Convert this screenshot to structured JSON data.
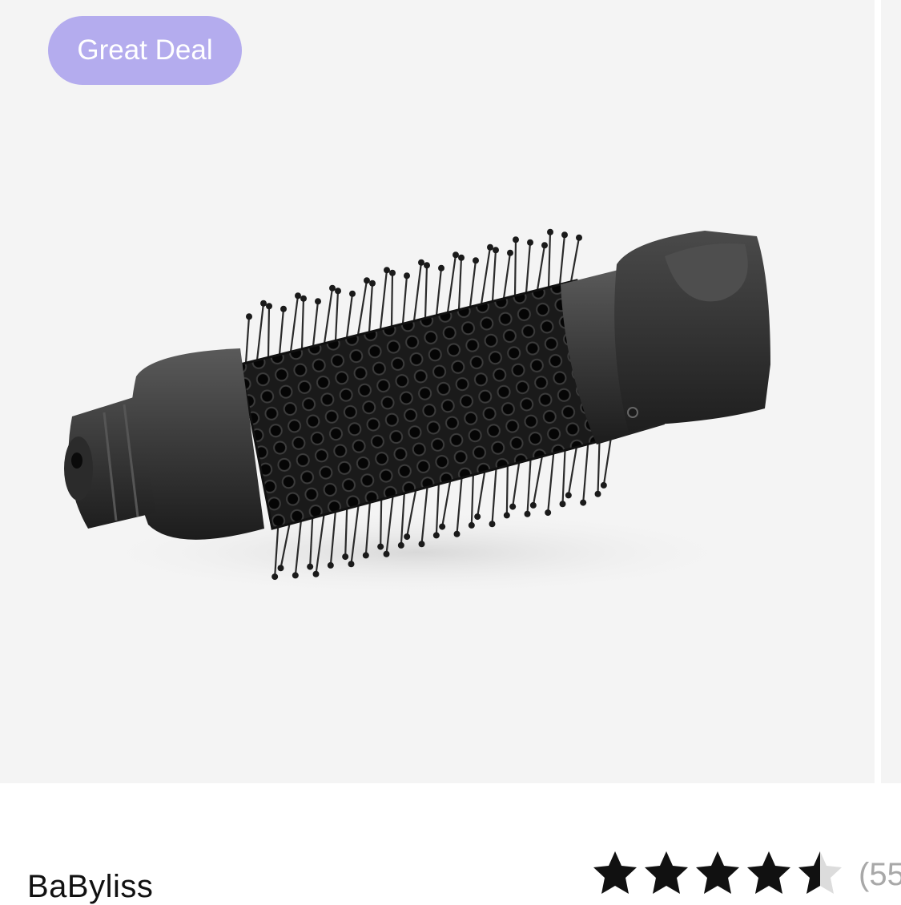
{
  "product_card": {
    "badge": {
      "label": "Great Deal",
      "color": "#b4acee"
    },
    "image": {
      "subject": "round hot-air brush attachment",
      "background": "#f4f4f4"
    },
    "brand": "BaByliss",
    "rating": {
      "value": 4.5,
      "max": 5,
      "count_text": "(55",
      "star_color": "#111111",
      "empty_color": "#dcdcdc"
    }
  },
  "icons": {
    "star": "star-icon"
  }
}
